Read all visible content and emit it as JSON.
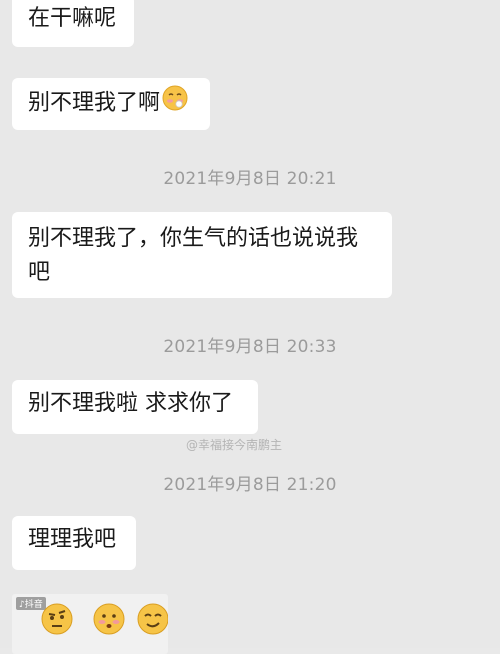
{
  "messages": [
    {
      "text": "在干嘛呢"
    },
    {
      "text": "别不理我了啊"
    },
    {
      "text": "别不理我了，你生气的话也说说我",
      "text2": "吧"
    },
    {
      "text": "别不理我啦 求求你了"
    },
    {
      "text": "理理我吧"
    }
  ],
  "timestamps": [
    "2021年9月8日 20:21",
    "2021年9月8日 20:33",
    "2021年9月8日 21:20"
  ],
  "watermark": "@幸福接今南鹏主",
  "media": {
    "badge": "♪抖音"
  },
  "icons": {
    "bubble_emoji": "shy-face-icon",
    "media_emojis": [
      "eyebrow-face-icon",
      "flushed-face-icon",
      "smirk-face-icon"
    ]
  },
  "colors": {
    "background": "#e8e8e8",
    "bubble": "#ffffff",
    "timestamp": "#9b9b9b"
  }
}
